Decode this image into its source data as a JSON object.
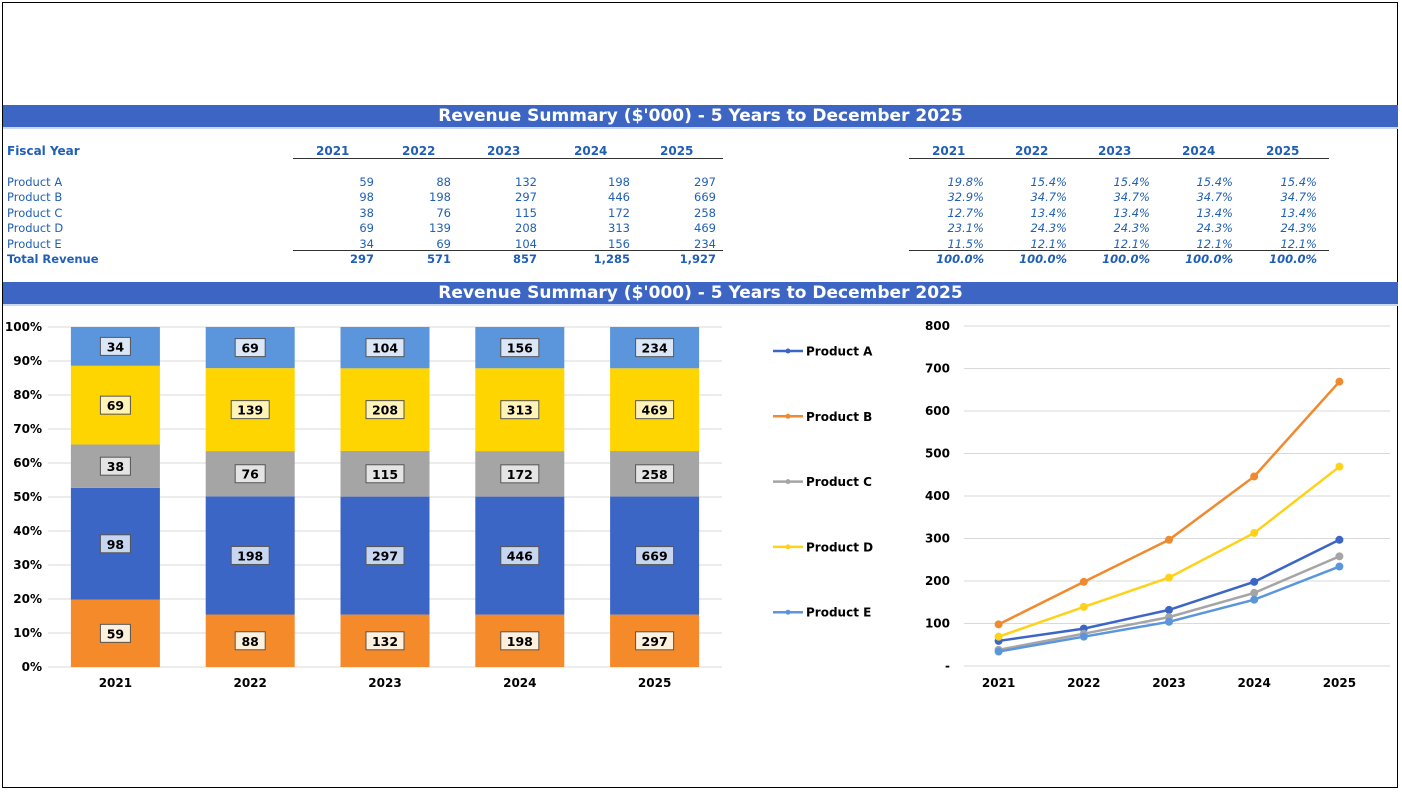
{
  "banner_top": "Revenue Summary ($'000) - 5 Years to December 2025",
  "banner_charts": "Revenue Summary ($'000) - 5 Years to December 2025",
  "table": {
    "row_header": "Fiscal Year",
    "years": [
      "2021",
      "2022",
      "2023",
      "2024",
      "2025"
    ],
    "rows": [
      {
        "label": "Product A",
        "values": [
          "59",
          "88",
          "132",
          "198",
          "297"
        ],
        "pcts": [
          "19.8%",
          "15.4%",
          "15.4%",
          "15.4%",
          "15.4%"
        ]
      },
      {
        "label": "Product B",
        "values": [
          "98",
          "198",
          "297",
          "446",
          "669"
        ],
        "pcts": [
          "32.9%",
          "34.7%",
          "34.7%",
          "34.7%",
          "34.7%"
        ]
      },
      {
        "label": "Product C",
        "values": [
          "38",
          "76",
          "115",
          "172",
          "258"
        ],
        "pcts": [
          "12.7%",
          "13.4%",
          "13.4%",
          "13.4%",
          "13.4%"
        ]
      },
      {
        "label": "Product D",
        "values": [
          "69",
          "139",
          "208",
          "313",
          "469"
        ],
        "pcts": [
          "23.1%",
          "24.3%",
          "24.3%",
          "24.3%",
          "24.3%"
        ]
      },
      {
        "label": "Product E",
        "values": [
          "34",
          "69",
          "104",
          "156",
          "234"
        ],
        "pcts": [
          "11.5%",
          "12.1%",
          "12.1%",
          "12.1%",
          "12.1%"
        ]
      }
    ],
    "total": {
      "label": "Total Revenue",
      "values": [
        "297",
        "571",
        "857",
        "1,285",
        "1,927"
      ],
      "pcts": [
        "100.0%",
        "100.0%",
        "100.0%",
        "100.0%",
        "100.0%"
      ]
    }
  },
  "chart_data": [
    {
      "type": "bar",
      "stacked": "percent",
      "title": "",
      "categories": [
        "2021",
        "2022",
        "2023",
        "2024",
        "2025"
      ],
      "ylim": [
        0,
        100
      ],
      "yticks": [
        "0%",
        "10%",
        "20%",
        "30%",
        "40%",
        "50%",
        "60%",
        "70%",
        "80%",
        "90%",
        "100%"
      ],
      "grid": true,
      "series": [
        {
          "name": "Product A",
          "values": [
            59,
            88,
            132,
            198,
            297
          ],
          "color": "#f58a2a",
          "label_bg": "#fdf0dd"
        },
        {
          "name": "Product B",
          "values": [
            98,
            198,
            297,
            446,
            669
          ],
          "color": "#3c66c6",
          "label_bg": "#c6d6f0"
        },
        {
          "name": "Product C",
          "values": [
            38,
            76,
            115,
            172,
            258
          ],
          "color": "#a5a5a5",
          "label_bg": "#e4e4e4"
        },
        {
          "name": "Product D",
          "values": [
            69,
            139,
            208,
            313,
            469
          ],
          "color": "#ffd500",
          "label_bg": "#fff3b8"
        },
        {
          "name": "Product E",
          "values": [
            34,
            69,
            104,
            156,
            234
          ],
          "color": "#5b96dd",
          "label_bg": "#dbe6f6"
        }
      ]
    },
    {
      "type": "line",
      "title": "",
      "categories": [
        "2021",
        "2022",
        "2023",
        "2024",
        "2025"
      ],
      "ylim": [
        0,
        800
      ],
      "yticks": [
        "-",
        "100",
        "200",
        "300",
        "400",
        "500",
        "600",
        "700",
        "800"
      ],
      "grid": true,
      "legend": "left",
      "series": [
        {
          "name": "Product A",
          "values": [
            59,
            88,
            132,
            198,
            297
          ],
          "color": "#3c66c6"
        },
        {
          "name": "Product B",
          "values": [
            98,
            198,
            297,
            446,
            669
          ],
          "color": "#f08a2e"
        },
        {
          "name": "Product C",
          "values": [
            38,
            76,
            115,
            172,
            258
          ],
          "color": "#a5a5a5"
        },
        {
          "name": "Product D",
          "values": [
            69,
            139,
            208,
            313,
            469
          ],
          "color": "#ffd21a"
        },
        {
          "name": "Product E",
          "values": [
            34,
            69,
            104,
            156,
            234
          ],
          "color": "#5b96dd"
        }
      ]
    }
  ]
}
